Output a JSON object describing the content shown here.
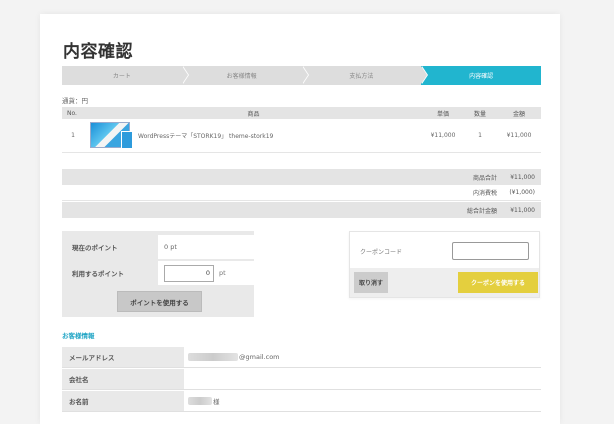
{
  "page": {
    "title": "内容確認",
    "currency_label": "通貨：円"
  },
  "steps": [
    {
      "label": "カート",
      "active": false
    },
    {
      "label": "お客様情報",
      "active": false
    },
    {
      "label": "支払方法",
      "active": false
    },
    {
      "label": "内容確認",
      "active": true
    }
  ],
  "table": {
    "headers": {
      "no": "No.",
      "product": "商品",
      "price": "単価",
      "qty": "数量",
      "amount": "金額"
    },
    "rows": [
      {
        "no": "1",
        "name": "WordPressテーマ「STORK19」 theme-stork19",
        "price": "¥11,000",
        "qty": "1",
        "amount": "¥11,000"
      }
    ]
  },
  "summary": {
    "subtotal_label": "商品合計",
    "subtotal_value": "¥11,000",
    "tax_label": "内消費税",
    "tax_value": "(¥1,000)",
    "total_label": "総合計金額",
    "total_value": "¥11,000"
  },
  "points": {
    "current_label": "現在のポイント",
    "current_value": "0 pt",
    "use_label": "利用するポイント",
    "use_value": "0",
    "use_unit": "pt",
    "button_label": "ポイントを使用する"
  },
  "coupon": {
    "label": "クーポンコード",
    "input_value": "",
    "cancel_label": "取り消す",
    "apply_label": "クーポンを使用する",
    "apply_color": "#e4cf3e"
  },
  "customer": {
    "heading": "お客様情報",
    "rows": [
      {
        "label": "メールアドレス",
        "value": "@gmail.com"
      },
      {
        "label": "会社名",
        "value": ""
      },
      {
        "label": "お名前",
        "value": "様"
      }
    ]
  },
  "colors": {
    "accent": "#21b5cf",
    "coupon": "#e4cf3e"
  }
}
